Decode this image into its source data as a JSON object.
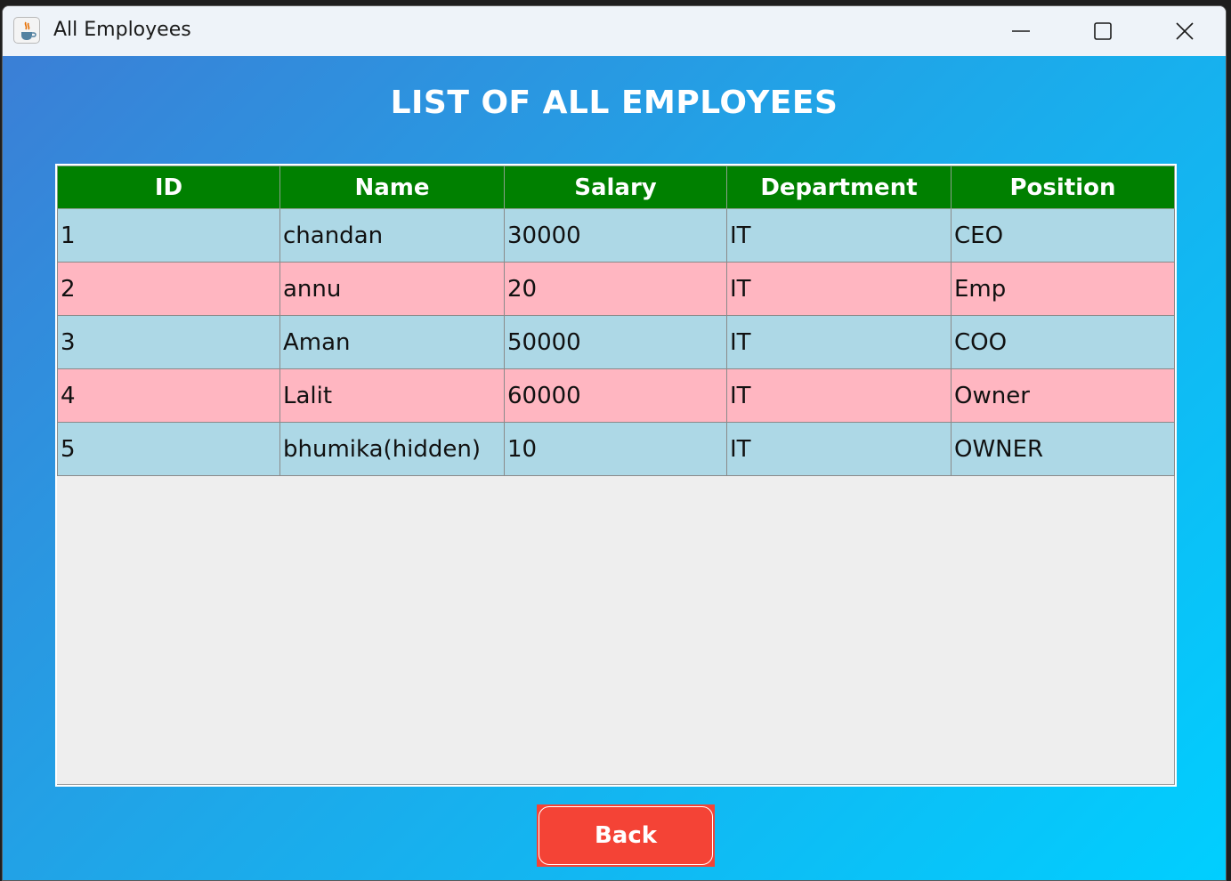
{
  "window": {
    "title": "All Employees",
    "icon": "java-cup-icon"
  },
  "page": {
    "heading": "LIST OF ALL EMPLOYEES"
  },
  "table": {
    "columns": [
      "ID",
      "Name",
      "Salary",
      "Department",
      "Position"
    ],
    "rows": [
      [
        "1",
        "chandan",
        "30000",
        "IT",
        "CEO"
      ],
      [
        "2",
        "annu",
        "20",
        "IT",
        "Emp"
      ],
      [
        "3",
        "Aman",
        "50000",
        "IT",
        "COO"
      ],
      [
        "4",
        "Lalit",
        "60000",
        "IT",
        "Owner"
      ],
      [
        "5",
        "bhumika(hidden)",
        "10",
        "IT",
        "OWNER"
      ]
    ]
  },
  "buttons": {
    "back_label": "Back"
  },
  "colors": {
    "header_bg": "#008000",
    "row_even": "#add8e6",
    "row_odd": "#ffb6c1",
    "back_button": "#f44336"
  }
}
